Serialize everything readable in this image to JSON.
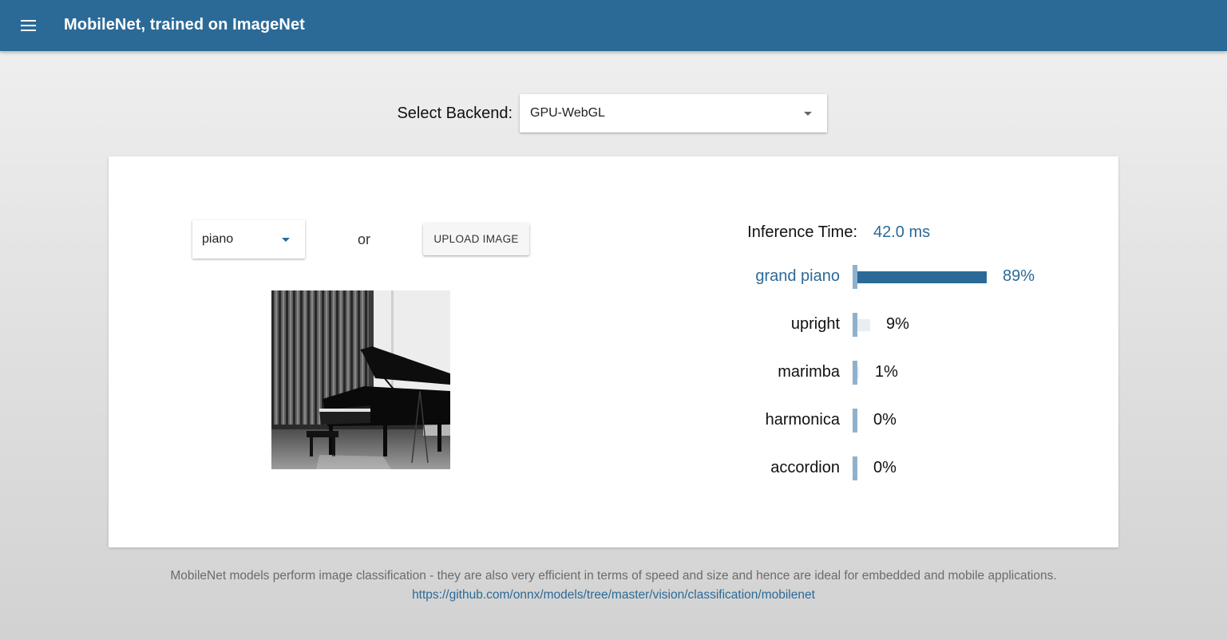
{
  "app": {
    "title": "MobileNet, trained on ImageNet"
  },
  "backend": {
    "label": "Select Backend:",
    "selected": "GPU-WebGL"
  },
  "input": {
    "image_selected": "piano",
    "or_text": "or",
    "upload_label": "UPLOAD IMAGE"
  },
  "inference": {
    "label": "Inference Time:",
    "value": "42.0 ms"
  },
  "predictions": [
    {
      "label": "grand piano",
      "value": "89%",
      "fraction": 0.89
    },
    {
      "label": "upright",
      "value": "9%",
      "fraction": 0.09
    },
    {
      "label": "marimba",
      "value": "1%",
      "fraction": 0.01
    },
    {
      "label": "harmonica",
      "value": "0%",
      "fraction": 0.0
    },
    {
      "label": "accordion",
      "value": "0%",
      "fraction": 0.0
    }
  ],
  "footer": {
    "description": "MobileNet models perform image classification - they are also very efficient in terms of speed and size and hence are ideal for embedded and mobile applications.",
    "link": "https://github.com/onnx/models/tree/master/vision/classification/mobilenet"
  },
  "colors": {
    "primary": "#2b6a97",
    "track": "#8fb1cd",
    "faint_bar": "#e8eef4"
  },
  "icons": {
    "menu": "hamburger-menu-icon",
    "dropdown": "chevron-down-icon"
  }
}
